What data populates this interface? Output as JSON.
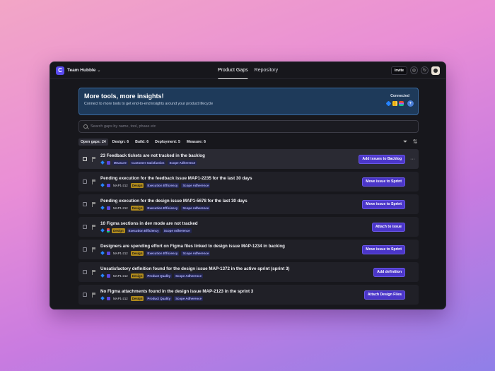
{
  "app": {
    "team_name": "Team Hubble",
    "logo_letter": "C"
  },
  "tabs": [
    {
      "label": "Product Gaps",
      "active": true
    },
    {
      "label": "Repository",
      "active": false
    }
  ],
  "topbar": {
    "invite_label": "Invite"
  },
  "banner": {
    "title": "More tools, more insights!",
    "subtitle": "Connect to more tools to get end-to-end insights around your product lifecycle",
    "connected_label": "Connected",
    "connected_tools": [
      "jira-icon",
      "bars-icon",
      "figma-icon"
    ]
  },
  "search": {
    "placeholder": "Search gaps by name, tool, phase etc"
  },
  "filters": [
    {
      "label": "Open gaps: 24",
      "active": true
    },
    {
      "label": "Design: 6",
      "active": false
    },
    {
      "label": "Build: 6",
      "active": false
    },
    {
      "label": "Deployment: 5",
      "active": false
    },
    {
      "label": "Measure: 6",
      "active": false
    }
  ],
  "gaps": [
    {
      "title": "23 Feedback tickets are not tracked in the backlog",
      "id": "",
      "phase": "Measure",
      "tags": [
        "Customer Satisfaction",
        "Scope Adherence"
      ],
      "action": "Add issues to Backlog"
    },
    {
      "title": "Pending execution for the feedback issue MAP1-2235 for the last 30 days",
      "id": "MAP1-212",
      "phase": "Design",
      "tags": [
        "Execution Efficiency",
        "Scope Adherence"
      ],
      "action": "Move issue to Sprint"
    },
    {
      "title": "Pending execution for the design issue MAP1-5678 for the last 30 days",
      "id": "MAP1-212",
      "phase": "Design",
      "tags": [
        "Execution Efficiency",
        "Scope Adherence"
      ],
      "action": "Move issue to Sprint"
    },
    {
      "title": "10 Figma sections in dev mode are not tracked",
      "id": "",
      "phase": "Design",
      "tags": [
        "Execution Efficiency",
        "Scope Adherence"
      ],
      "action": "Attach to issue"
    },
    {
      "title": "Designers are spending effort on Figma files linked to design issue MAP-1234 in backlog",
      "id": "MAP1-212",
      "phase": "Design",
      "tags": [
        "Execution Efficiency",
        "Scope Adherence"
      ],
      "action": "Move issue to Sprint"
    },
    {
      "title": "Unsatisfactory definition found for the design issue MAP-1372 in the active sprint (sprint 3)",
      "id": "MAP1-212",
      "phase": "Design",
      "tags": [
        "Product Quality",
        "Scope Adherence"
      ],
      "action": "Add definition"
    },
    {
      "title": "No Figma attachments found in the design issue MAP-2123 in the sprint 3",
      "id": "MAP1-212",
      "phase": "Design",
      "tags": [
        "Product Quality",
        "Scope Adherence"
      ],
      "action": "Attach Design Files"
    }
  ]
}
